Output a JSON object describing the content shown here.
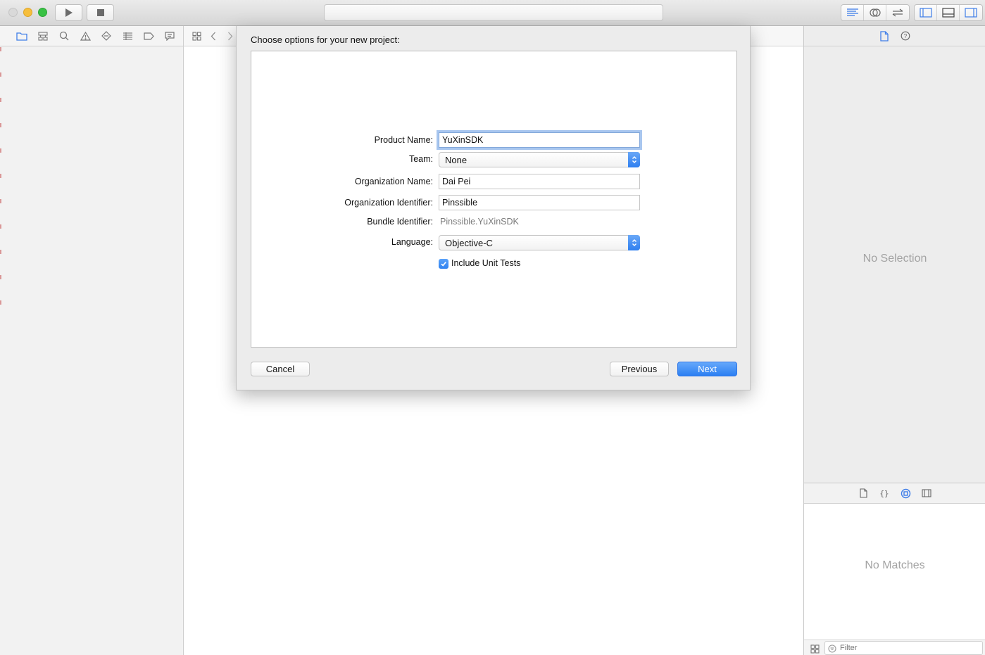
{
  "dialog": {
    "title": "Choose options for your new project:",
    "fields": {
      "product_name_label": "Product Name:",
      "product_name_value": "YuXinSDK",
      "team_label": "Team:",
      "team_value": "None",
      "org_name_label": "Organization Name:",
      "org_name_value": "Dai Pei",
      "org_id_label": "Organization Identifier:",
      "org_id_value": "Pinssible",
      "bundle_id_label": "Bundle Identifier:",
      "bundle_id_value": "Pinssible.YuXinSDK",
      "language_label": "Language:",
      "language_value": "Objective-C",
      "unit_tests_label": "Include Unit Tests",
      "unit_tests_checked": true
    },
    "buttons": {
      "cancel": "Cancel",
      "previous": "Previous",
      "next": "Next"
    }
  },
  "inspector": {
    "no_selection": "No Selection",
    "no_matches": "No Matches",
    "filter_placeholder": "Filter"
  },
  "colors": {
    "accent": "#2f7ff0",
    "focus_ring": "#a8c6ef",
    "traffic_close": "#d9d9d9",
    "traffic_minimize": "#f6be3c",
    "traffic_maximize": "#38c144"
  },
  "icons": {
    "toolbar": [
      "play-icon",
      "stop-icon",
      "standard-editor-icon",
      "assistant-editor-icon",
      "version-editor-icon",
      "navigator-toggle-icon",
      "debug-area-toggle-icon",
      "utilities-toggle-icon"
    ],
    "navigator": [
      "folder-icon",
      "symbol-icon",
      "search-icon",
      "warning-icon",
      "test-icon",
      "debug-icon",
      "breakpoint-icon",
      "report-icon"
    ],
    "inspector": [
      "file-inspector-icon",
      "help-icon"
    ],
    "library": [
      "file-template-icon",
      "code-snippet-icon",
      "object-library-icon",
      "media-library-icon"
    ]
  }
}
